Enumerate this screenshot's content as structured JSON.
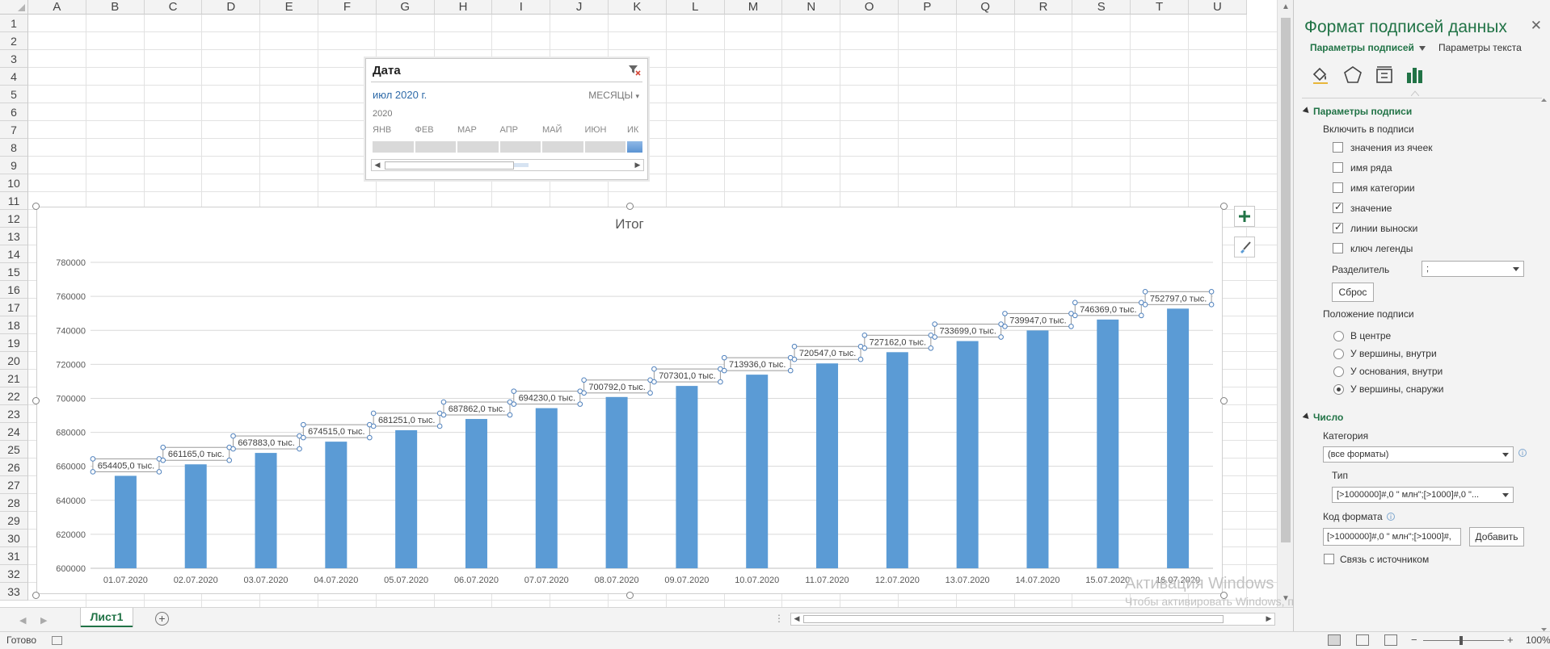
{
  "sheet": {
    "columns": [
      "A",
      "B",
      "C",
      "D",
      "E",
      "F",
      "G",
      "H",
      "I",
      "J",
      "K",
      "L",
      "M",
      "N",
      "O",
      "P",
      "Q",
      "R",
      "S",
      "T",
      "U"
    ],
    "rows": [
      "1",
      "2",
      "3",
      "4",
      "5",
      "6",
      "7",
      "8",
      "9",
      "10",
      "11",
      "12",
      "13",
      "14",
      "15",
      "16",
      "17",
      "18",
      "19",
      "20",
      "21",
      "22",
      "23",
      "24",
      "25",
      "26",
      "27",
      "28",
      "29",
      "30",
      "31",
      "32",
      "33"
    ]
  },
  "slicer": {
    "title": "Дата",
    "period": "июл 2020 г.",
    "level": "МЕСЯЦЫ",
    "year": "2020",
    "months": [
      "ЯНВ",
      "ФЕВ",
      "МАР",
      "АПР",
      "МАЙ",
      "ИЮН",
      "ИК"
    ],
    "selected_month_index": 6,
    "icon_filter": "clear-filter-icon"
  },
  "chart_data": {
    "type": "bar",
    "title": "Итог",
    "categories": [
      "01.07.2020",
      "02.07.2020",
      "03.07.2020",
      "04.07.2020",
      "05.07.2020",
      "06.07.2020",
      "07.07.2020",
      "08.07.2020",
      "09.07.2020",
      "10.07.2020",
      "11.07.2020",
      "12.07.2020",
      "13.07.2020",
      "14.07.2020",
      "15.07.2020",
      "16.07.2020"
    ],
    "values": [
      654405,
      661165,
      667883,
      674515,
      681251,
      687862,
      694230,
      700792,
      707301,
      713936,
      720547,
      727162,
      733699,
      739947,
      746369,
      752797
    ],
    "data_labels": [
      "654405,0  тыс.",
      "661165,0  тыс.",
      "667883,0  тыс.",
      "674515,0  тыс.",
      "681251,0  тыс.",
      "687862,0  тыс.",
      "694230,0  тыс.",
      "700792,0  тыс.",
      "707301,0  тыс.",
      "713936,0  тыс.",
      "720547,0  тыс.",
      "727162,0  тыс.",
      "733699,0  тыс.",
      "739947,0  тыс.",
      "746369,0  тыс.",
      "752797,0  тыс."
    ],
    "y_ticks": [
      "600000",
      "620000",
      "640000",
      "660000",
      "680000",
      "700000",
      "720000",
      "740000",
      "760000",
      "780000"
    ],
    "ylim": [
      600000,
      790000
    ],
    "y_tick_step": 20000,
    "grid": true,
    "bar_color": "#5b9bd5",
    "legend": "none"
  },
  "chart_buttons": {
    "add_element_icon": "plus-icon",
    "style_icon": "brush-icon"
  },
  "tabs": {
    "sheet1": "Лист1",
    "add_icon": "plus-circle-icon"
  },
  "status": {
    "ready": "Готово",
    "zoom": "100%",
    "zoom_minus": "−",
    "zoom_plus": "+"
  },
  "watermark": {
    "line1": "Активация Windows",
    "line2": "Чтобы активировать Windows, перейдите в раздел \"Параметры\"."
  },
  "pane": {
    "title": "Формат подписей данных",
    "close": "✕",
    "tab_label_options": "Параметры подписей",
    "tab_text_options": "Параметры текста",
    "icons": [
      "fill-line-icon",
      "effects-pentagon-icon",
      "size-properties-icon",
      "label-options-bar-icon"
    ],
    "section_label": "Параметры подписи",
    "include_in_label": "Включить в подписи",
    "checkboxes": [
      {
        "label": "значения из ячеек",
        "checked": false
      },
      {
        "label": "имя ряда",
        "checked": false
      },
      {
        "label": "имя категории",
        "checked": false
      },
      {
        "label": "значение",
        "checked": true
      },
      {
        "label": "линии выноски",
        "checked": true
      },
      {
        "label": "ключ легенды",
        "checked": false
      }
    ],
    "separator_label": "Разделитель",
    "separator_value": ";",
    "reset_button": "Сброс",
    "position_label": "Положение подписи",
    "radios": [
      {
        "label": "В центре",
        "checked": false
      },
      {
        "label": "У вершины, внутри",
        "checked": false
      },
      {
        "label": "У основания, внутри",
        "checked": false
      },
      {
        "label": "У вершины, снаружи",
        "checked": true
      }
    ],
    "number_section": "Число",
    "category_label": "Категория",
    "category_value": "(все форматы)",
    "type_label": "Тип",
    "type_value": "[>1000000]#,0 \" млн\";[>1000]#,0 \"...",
    "format_code_label": "Код формата",
    "format_code_value": "[>1000000]#,0 \" млн\";[>1000]#,",
    "add_button": "Добавить",
    "link_label": "Связь с источником",
    "link_checked": false
  },
  "colors": {
    "excel_green": "#217346",
    "bar_blue": "#5b9bd5",
    "grid": "#d9d9d9"
  }
}
